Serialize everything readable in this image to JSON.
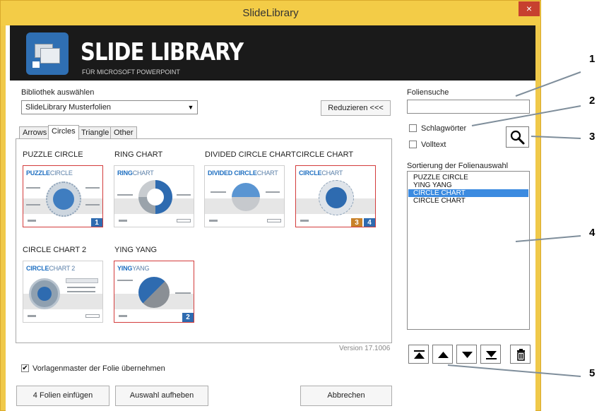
{
  "window": {
    "title": "SlideLibrary",
    "close": "×"
  },
  "banner": {
    "title": "SLIDE LIBRARY",
    "subtitle": "FÜR MICROSOFT POWERPOINT"
  },
  "library": {
    "label": "Bibliothek auswählen",
    "value": "SlideLibrary Musterfolien"
  },
  "reduce_button": "Reduzieren <<<",
  "tabs": [
    {
      "label": "Arrows",
      "active": false
    },
    {
      "label": "Circles",
      "active": true
    },
    {
      "label": "Triangle",
      "active": false
    },
    {
      "label": "Other",
      "active": false
    }
  ],
  "slides": [
    {
      "title": "PUZZLE CIRCLE",
      "head_bold": "PUZZLE",
      "head_thin": "CIRCLE",
      "selected": true,
      "badges": [
        "1"
      ]
    },
    {
      "title": "RING CHART",
      "head_bold": "RING",
      "head_thin": "CHART",
      "selected": false,
      "badges": []
    },
    {
      "title": "DIVIDED CIRCLE CHART",
      "head_bold": "DIVIDED CIRCLE",
      "head_thin": "CHART",
      "selected": false,
      "badges": []
    },
    {
      "title": "CIRCLE CHART",
      "head_bold": "CIRCLE",
      "head_thin": "CHART",
      "selected": true,
      "badges": [
        "3",
        "4"
      ]
    },
    {
      "title": "CIRCLE CHART 2",
      "head_bold": "CIRCLE",
      "head_thin": "CHART 2",
      "selected": false,
      "badges": []
    },
    {
      "title": "YING YANG",
      "head_bold": "YING",
      "head_thin": "YANG",
      "selected": true,
      "badges": [
        "2"
      ]
    }
  ],
  "version": "Version 17.1006",
  "search": {
    "label": "Foliensuche",
    "value": "",
    "keywords_label": "Schlagwörter",
    "keywords_checked": false,
    "fulltext_label": "Volltext",
    "fulltext_checked": false
  },
  "sorting": {
    "label": "Sortierung der Folienauswahl",
    "items": [
      "PUZZLE CIRCLE",
      "YING YANG",
      "CIRCLE CHART",
      "CIRCLE CHART"
    ],
    "selected_index": 2
  },
  "master_checkbox": {
    "label": "Vorlagenmaster der Folie übernehmen",
    "checked": true,
    "mark": "✔"
  },
  "buttons": {
    "insert": "4 Folien einfügen",
    "deselect": "Auswahl aufheben",
    "cancel": "Abbrechen"
  },
  "callouts": [
    "1",
    "2",
    "3",
    "4",
    "5"
  ],
  "colors": {
    "title_bar": "#f3cc47",
    "selection": "#3c8be0",
    "accent_blue": "#2e6bb0",
    "badge_orange": "#c9822a",
    "thumb_selected_border": "#d33c3c"
  }
}
